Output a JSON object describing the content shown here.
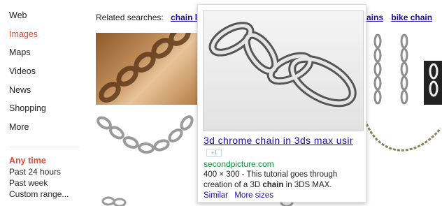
{
  "nav": {
    "items": [
      {
        "label": "Web"
      },
      {
        "label": "Images",
        "active": true
      },
      {
        "label": "Maps"
      },
      {
        "label": "Videos"
      },
      {
        "label": "News"
      },
      {
        "label": "Shopping"
      },
      {
        "label": "More"
      }
    ]
  },
  "time_filter": {
    "title": "Any time",
    "options": [
      "Past 24 hours",
      "Past week",
      "Custom range..."
    ]
  },
  "related": {
    "label": "Related searches:",
    "links": [
      "chain lin",
      "ains",
      "bike chain"
    ]
  },
  "preview": {
    "title": "3d chrome chain in 3ds max usir",
    "plus_one": "+1",
    "source": "secondpicture.com",
    "desc_prefix": "400 × 300 - This tutorial goes through creation of a 3D ",
    "desc_bold": "chain",
    "desc_suffix": " in 3DS MAX.",
    "links": [
      "Similar",
      "More sizes"
    ]
  },
  "colors": {
    "link": "#1a0dab",
    "active": "#dd4b39",
    "url_green": "#009933"
  }
}
